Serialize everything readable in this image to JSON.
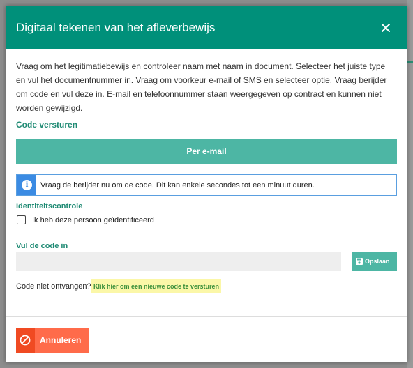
{
  "dialog": {
    "title": "Digitaal tekenen van het afleverbewijs",
    "intro": "Vraag om het legitimatiebewijs en controleer naam met naam in document. Selecteer het juiste type en vul het documentnummer in. Vraag om voorkeur e-mail of SMS en selecteer optie. Vraag berijder om code en vul deze in. E-mail en telefoonnummer staan weergegeven op contract en kunnen niet worden gewijzigd."
  },
  "code_section": {
    "title": "Code versturen",
    "email_button": "Per e-mail"
  },
  "info": {
    "icon": "info-icon",
    "text": "Vraag de berijder nu om de code. Dit kan enkele secondes tot een minuut duren."
  },
  "identity": {
    "title": "Identiteitscontrole",
    "checkbox_label": "Ik heb deze persoon geïdentificeerd",
    "checked": false
  },
  "code_entry": {
    "title": "Vul de code in",
    "value": "",
    "save_button": "Opslaan",
    "save_icon": "floppy-disk-icon"
  },
  "resend": {
    "question": "Code niet ontvangen?",
    "link": "Klik hier om een nieuwe code te versturen"
  },
  "footer": {
    "cancel_button": "Annuleren",
    "cancel_icon": "ban-icon"
  },
  "colors": {
    "header": "#00907a",
    "primary_button": "#4db6a4",
    "info_accent": "#3b8be3",
    "cancel": "#ff6b4a",
    "link_highlight": "#fbf7a8"
  }
}
